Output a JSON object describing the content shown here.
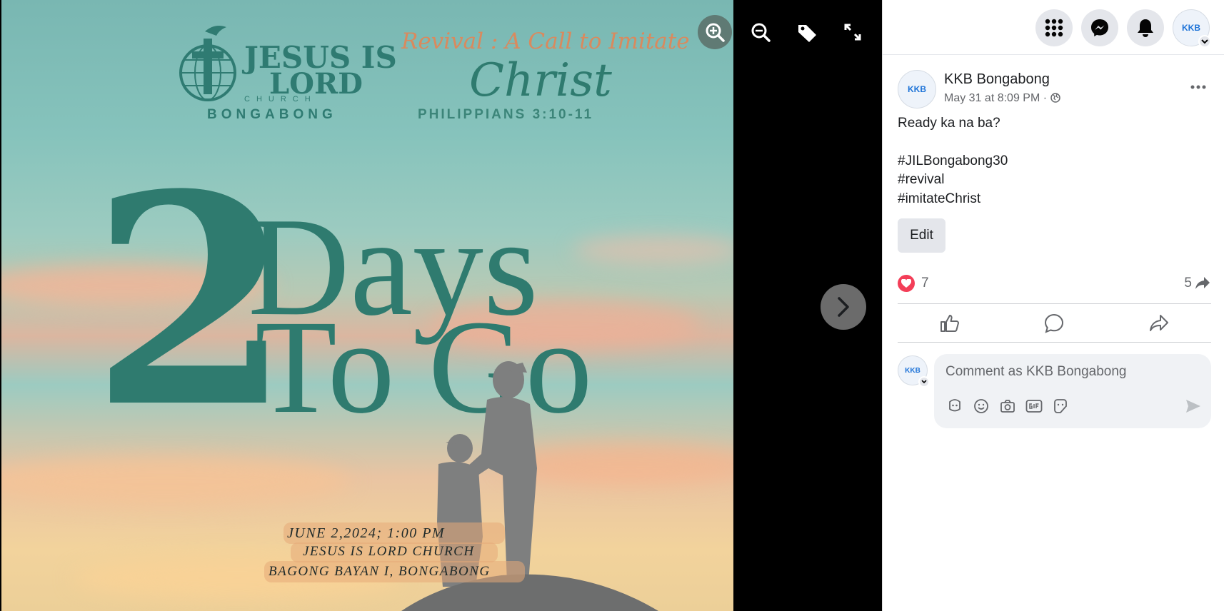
{
  "poster": {
    "church_name_line1": "JESUS IS",
    "church_name_line2": "LORD",
    "church_word": "CHURCH",
    "church_location": "BONGABONG",
    "theme_script": "Revival : A Call to Imitate",
    "theme_christ": "Christ",
    "scripture": "PHILIPPIANS 3:10-11",
    "big_number": "2",
    "big_word_1": "Days",
    "big_word_2": "To Go",
    "event_date": "JUNE 2,2024; 1:00 PM",
    "event_venue": "JESUS IS LORD CHURCH",
    "event_address": "BAGONG BAYAN I, BONGABONG"
  },
  "viewer_controls": {
    "zoom_in": "zoom-in-icon",
    "zoom_out": "zoom-out-icon",
    "tag": "tag-icon",
    "fullscreen": "fullscreen-icon",
    "next": "chevron-right-icon"
  },
  "topbar": {
    "avatar_initials": "KKB"
  },
  "post": {
    "author": "KKB Bongabong",
    "timestamp": "May 31 at 8:09 PM",
    "separator": "·",
    "text_line1": "Ready ka na ba?",
    "hashtag1": "#JILBongabong30",
    "hashtag2": "#revival",
    "hashtag3": "#imitateChrist",
    "edit_label": "Edit",
    "reaction_count": "7",
    "share_count": "5",
    "comment_placeholder": "Comment as KKB Bongabong",
    "avatar_initials": "KKB"
  },
  "colors": {
    "poster_teal": "#2f7b6f",
    "theme_orange": "#d98a5e",
    "love_red": "#f33e58",
    "sidebar_bg": "#ffffff"
  }
}
